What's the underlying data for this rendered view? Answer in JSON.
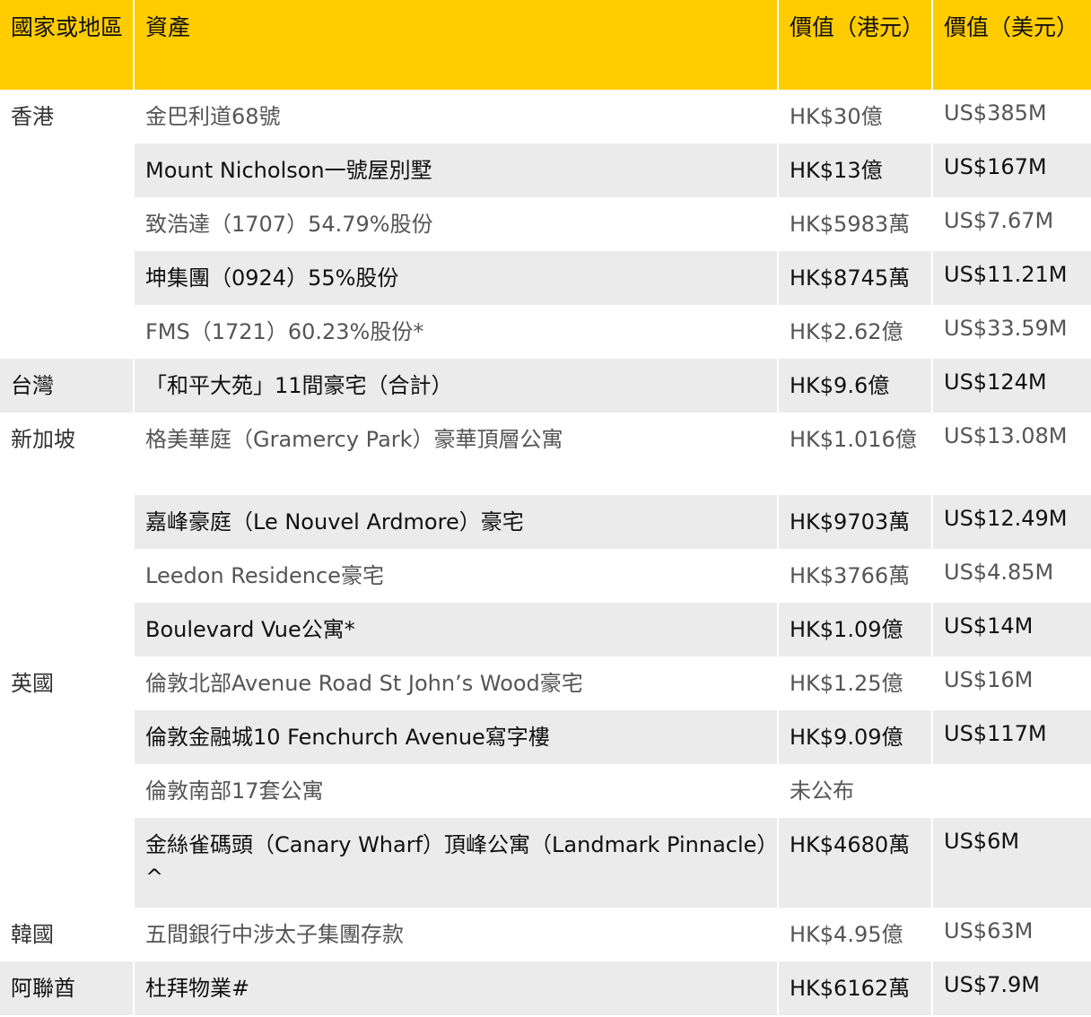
{
  "table": {
    "headers": {
      "country": "國家或地區",
      "asset": "資產",
      "value_hkd": "價值（港元）",
      "value_usd": "價值（美元）"
    },
    "rows": [
      {
        "country": "香港",
        "asset": "金巴利道68號",
        "hkd": "HK$30億",
        "usd": "US$385M"
      },
      {
        "country": "",
        "asset": "Mount Nicholson一號屋別墅",
        "hkd": "HK$13億",
        "usd": "US$167M"
      },
      {
        "country": "",
        "asset": "致浩達（1707）54.79%股份",
        "hkd": "HK$5983萬",
        "usd": "US$7.67M"
      },
      {
        "country": "",
        "asset": "坤集團（0924）55%股份",
        "hkd": "HK$8745萬",
        "usd": "US$11.21M"
      },
      {
        "country": "",
        "asset": "FMS（1721）60.23%股份*",
        "hkd": "HK$2.62億",
        "usd": "US$33.59M"
      },
      {
        "country": "台灣",
        "asset": "「和平大苑」11間豪宅（合計）",
        "hkd": "HK$9.6億",
        "usd": "US$124M"
      },
      {
        "country": "新加坡",
        "asset": "格美華庭（Gramercy Park）豪華頂層公寓",
        "hkd": "HK$1.016億",
        "usd": "US$13.08M"
      },
      {
        "country": "",
        "asset": "嘉峰豪庭（Le Nouvel Ardmore）豪宅",
        "hkd": "HK$9703萬",
        "usd": "US$12.49M"
      },
      {
        "country": "",
        "asset": "Leedon Residence豪宅",
        "hkd": "HK$3766萬",
        "usd": "US$4.85M"
      },
      {
        "country": "",
        "asset": "Boulevard Vue公寓*",
        "hkd": "HK$1.09億",
        "usd": "US$14M"
      },
      {
        "country": "英國",
        "asset": "倫敦北部Avenue Road St John’s Wood豪宅",
        "hkd": "HK$1.25億",
        "usd": "US$16M"
      },
      {
        "country": "",
        "asset": "倫敦金融城10 Fenchurch Avenue寫字樓",
        "hkd": "HK$9.09億",
        "usd": "US$117M"
      },
      {
        "country": "",
        "asset": "倫敦南部17套公寓",
        "hkd": "未公布",
        "usd": ""
      },
      {
        "country": "",
        "asset": "金絲雀碼頭（Canary Wharf）頂峰公寓（Landmark Pinnacle）^",
        "hkd": "HK$4680萬",
        "usd": "US$6M"
      },
      {
        "country": "韓國",
        "asset": "五間銀行中涉太子集團存款",
        "hkd": "HK$4.95億",
        "usd": "US$63M"
      },
      {
        "country": "阿聯酋",
        "asset": "杜拜物業#",
        "hkd": "HK$6162萬",
        "usd": "US$7.9M"
      }
    ]
  },
  "colors": {
    "header_bg": "#ffcc00",
    "shaded_row_bg": "#ebebeb"
  }
}
